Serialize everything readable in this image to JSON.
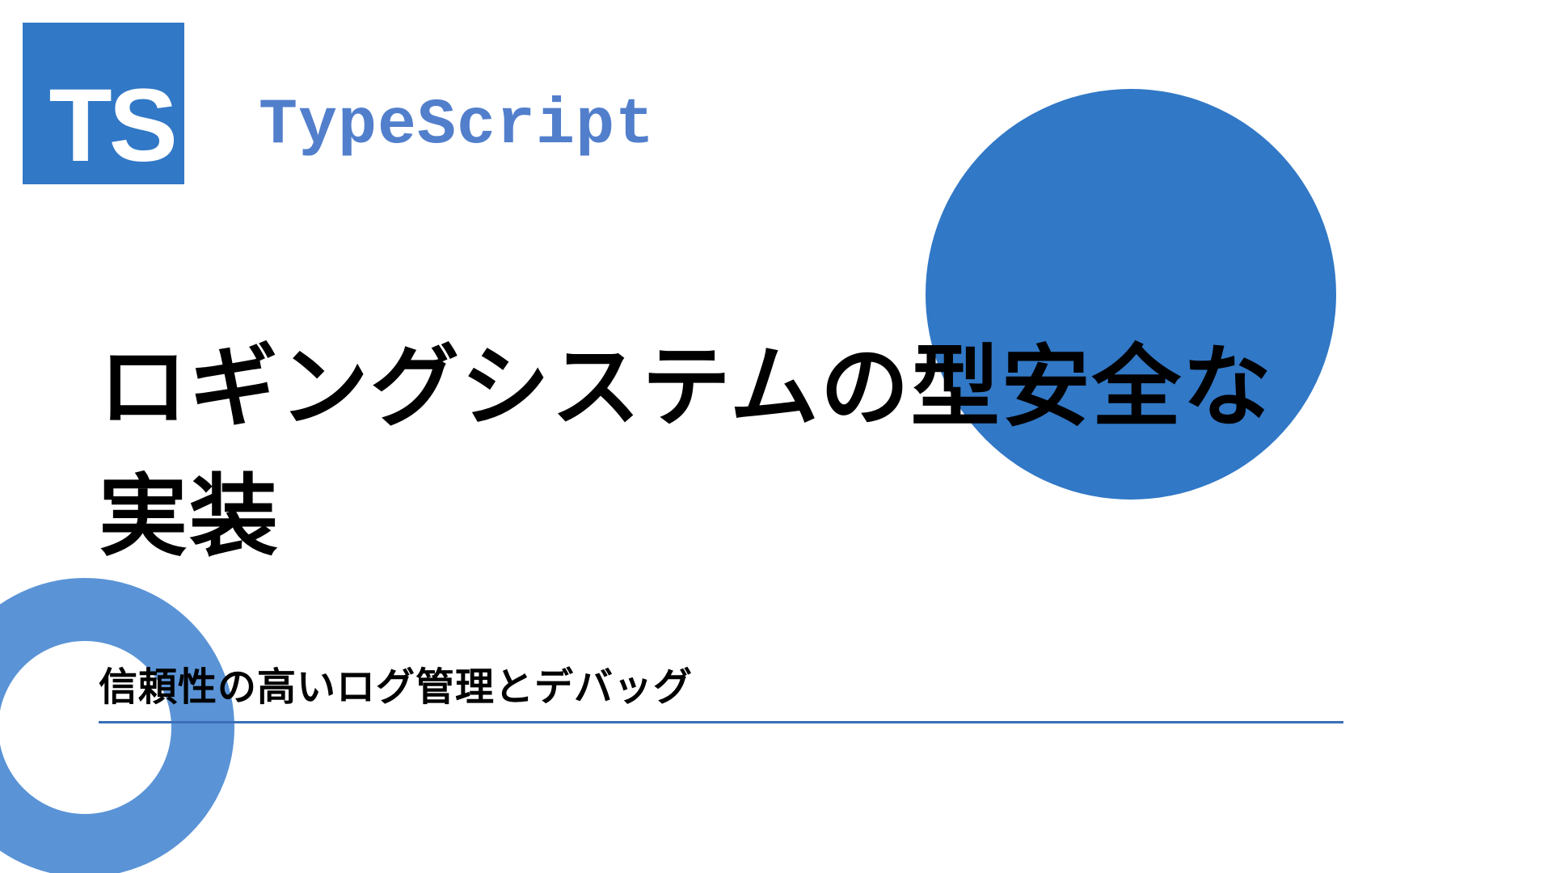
{
  "logo": {
    "text": "TS"
  },
  "brand": {
    "label": "TypeScript"
  },
  "title": "ロギングシステムの型安全な実装",
  "subtitle": "信頼性の高いログ管理とデバッグ",
  "colors": {
    "brand_blue": "#3178c6",
    "label_blue": "#527fcc",
    "ring_blue": "#5a93d6",
    "underline_blue": "#3a6fb7"
  }
}
